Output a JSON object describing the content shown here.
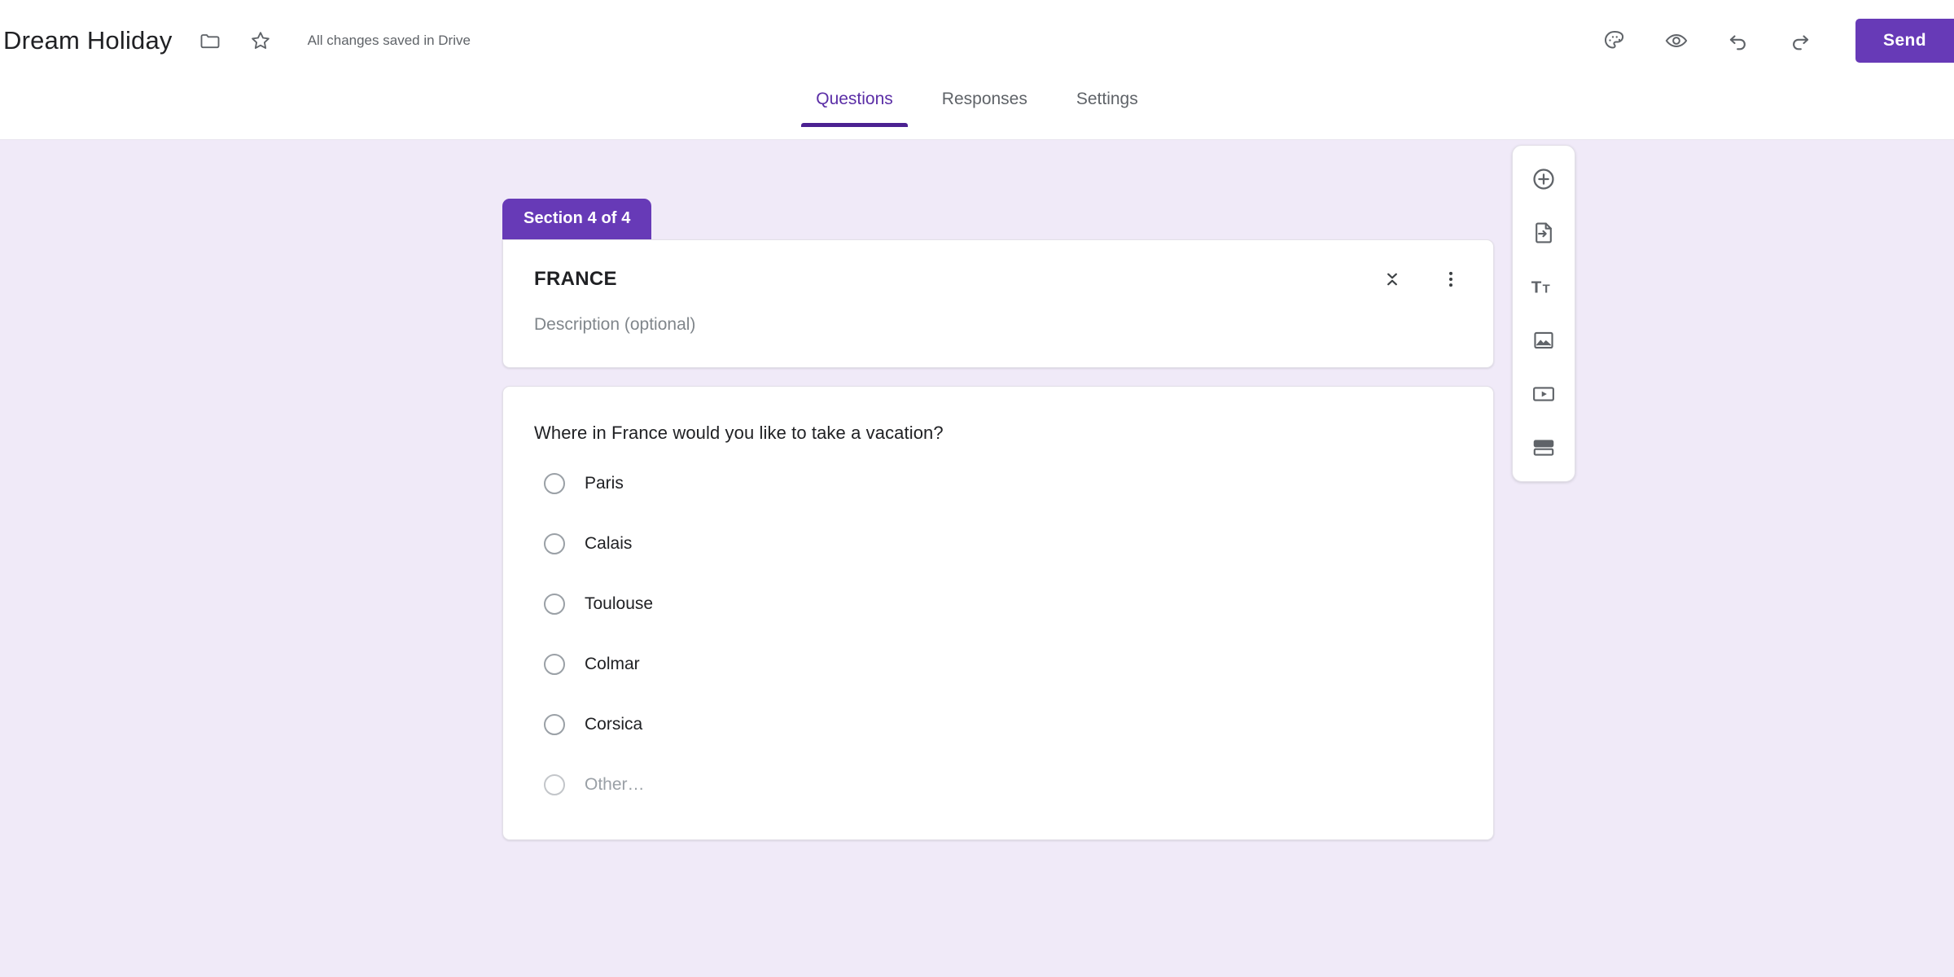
{
  "header": {
    "doc_title": "Dream Holiday",
    "folder_icon": "folder-icon",
    "star_icon": "star-icon",
    "save_status": "All changes saved in Drive",
    "theme_icon": "palette-icon",
    "preview_icon": "eye-icon",
    "undo_icon": "undo-icon",
    "redo_icon": "redo-icon",
    "send_label": "Send",
    "accent_color": "#673AB7"
  },
  "tabs": [
    {
      "label": "Questions",
      "active": true
    },
    {
      "label": "Responses",
      "active": false
    },
    {
      "label": "Settings",
      "active": false
    }
  ],
  "section": {
    "badge": "Section 4 of 4",
    "title": "FRANCE",
    "description_placeholder": "Description (optional)",
    "collapse_icon": "collapse-icon",
    "more_icon": "more-vert-icon"
  },
  "question": {
    "text": "Where in France would you like to take a vacation?",
    "type": "multiple-choice",
    "options": [
      {
        "label": "Paris",
        "selected": false,
        "other": false
      },
      {
        "label": "Calais",
        "selected": false,
        "other": false
      },
      {
        "label": "Toulouse",
        "selected": false,
        "other": false
      },
      {
        "label": "Colmar",
        "selected": false,
        "other": false
      },
      {
        "label": "Corsica",
        "selected": false,
        "other": false
      },
      {
        "label": "Other…",
        "selected": false,
        "other": true
      }
    ]
  },
  "side_toolbar": [
    {
      "icon": "add-question-icon",
      "tooltip": "Add question"
    },
    {
      "icon": "import-questions-icon",
      "tooltip": "Import questions"
    },
    {
      "icon": "add-title-icon",
      "tooltip": "Add title and description"
    },
    {
      "icon": "add-image-icon",
      "tooltip": "Add image"
    },
    {
      "icon": "add-video-icon",
      "tooltip": "Add video"
    },
    {
      "icon": "add-section-icon",
      "tooltip": "Add section"
    }
  ],
  "colors": {
    "canvas_background": "#F0EAF8",
    "accent_purple": "#673AB7",
    "tab_active": "#4B2191",
    "text_primary": "#202124",
    "text_secondary": "#5F6368"
  }
}
